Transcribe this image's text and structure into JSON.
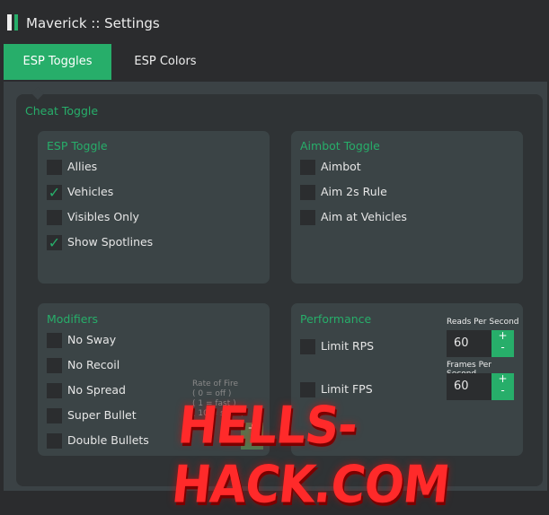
{
  "window": {
    "title": "Maverick :: Settings"
  },
  "tabs": [
    {
      "label": "ESP Toggles",
      "active": true
    },
    {
      "label": "ESP Colors",
      "active": false
    }
  ],
  "section_title": "Cheat Toggle",
  "esp_toggle": {
    "title": "ESP Toggle",
    "items": [
      {
        "label": "Allies",
        "checked": false
      },
      {
        "label": "Vehicles",
        "checked": true
      },
      {
        "label": "Visibles Only",
        "checked": false
      },
      {
        "label": "Show Spotlines",
        "checked": true
      }
    ]
  },
  "aimbot_toggle": {
    "title": "Aimbot Toggle",
    "items": [
      {
        "label": "Aimbot",
        "checked": false
      },
      {
        "label": "Aim 2s Rule",
        "checked": false
      },
      {
        "label": "Aim at Vehicles",
        "checked": false
      }
    ]
  },
  "modifiers": {
    "title": "Modifiers",
    "items": [
      {
        "label": "No Sway",
        "checked": false
      },
      {
        "label": "No Recoil",
        "checked": false
      },
      {
        "label": "No Spread",
        "checked": false
      },
      {
        "label": "Super Bullet",
        "checked": false
      },
      {
        "label": "Double Bullets",
        "checked": false
      }
    ],
    "rate_of_fire": {
      "label": "Rate of Fire",
      "hint1": "( 0 = off )",
      "hint2": "( 1 = fast )",
      "hint3": "( 10 = slow )"
    }
  },
  "performance": {
    "title": "Performance",
    "items": [
      {
        "label": "Limit RPS",
        "checked": false
      },
      {
        "label": "Limit FPS",
        "checked": false
      }
    ],
    "reads_per_second": {
      "label": "Reads Per Second",
      "value": "60"
    },
    "frames_per_second": {
      "label": "Frames Per Second",
      "value": "60"
    },
    "plus": "+",
    "minus": "-"
  },
  "check_glyph": "✓",
  "watermark": "HELLS-HACK.COM",
  "colors": {
    "accent": "#27ae6a",
    "background": "#2b2c2e",
    "panel": "#3b4446"
  }
}
